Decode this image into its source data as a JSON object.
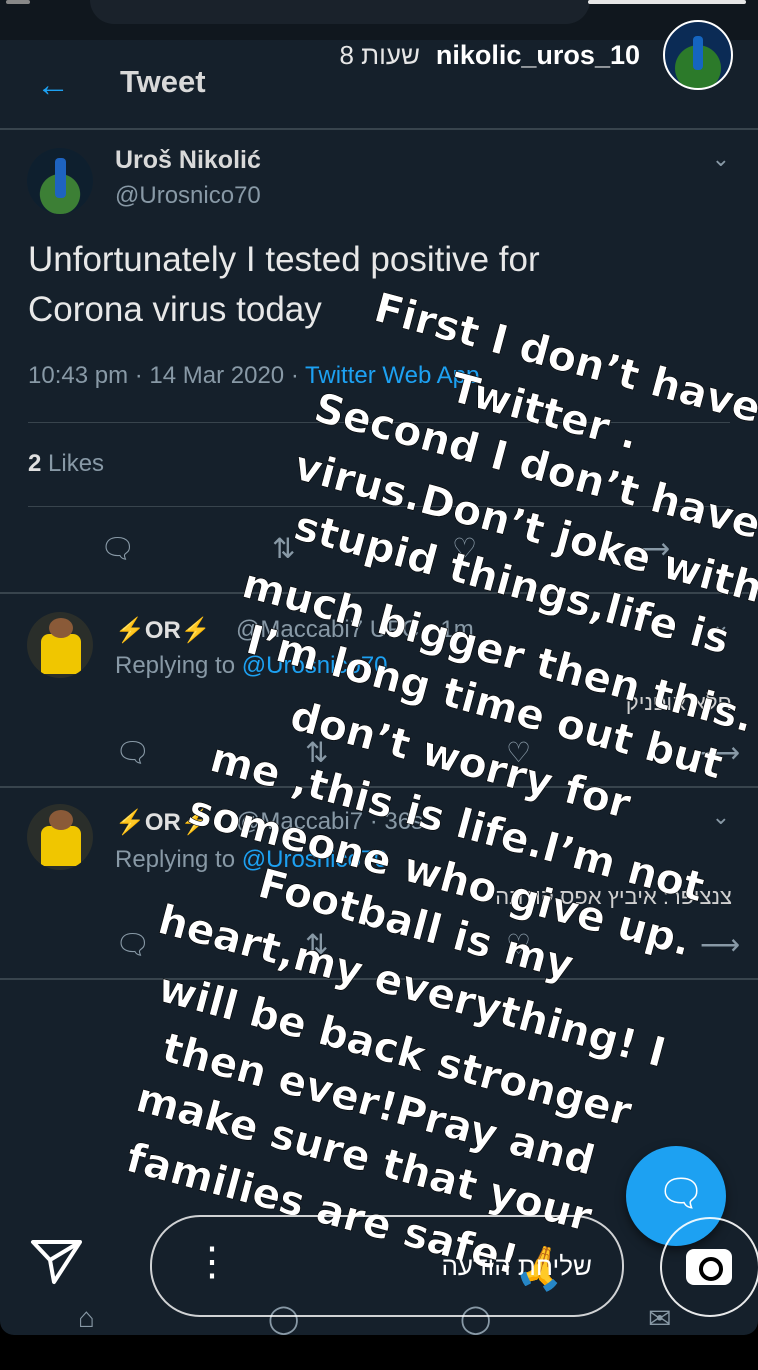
{
  "story": {
    "username": "nikolic_uros_10",
    "time": "8 שעות"
  },
  "header": {
    "back_icon": "←",
    "title": "Tweet"
  },
  "tweet": {
    "name": "Uroš Nikolić",
    "handle": "@Urosnico70",
    "text": "Unfortunately I tested positive for Corona virus today",
    "time": "10:43 pm · 14 Mar 2020 · ",
    "source": "Twitter Web App",
    "likes_count": "2",
    "likes_label": " Likes"
  },
  "replies": [
    {
      "name": "⚡OR⚡",
      "handle": "@Maccabi7 UFC · 1m",
      "replying": "Replying to ",
      "replying_to": "@Urosnico70",
      "text": "חלא אופניק"
    },
    {
      "name": "⚡OR⚡",
      "handle": "@Maccabi7 · 36s",
      "replying": "Replying to ",
      "replying_to": "@Urosnico70",
      "text": "צנציפר: איביץ אפס קורונה"
    }
  ],
  "overlay_lines": [
    "First I don’t have",
    "Twitter .",
    "Second I don’t have",
    "virus.Don’t joke with",
    "stupid things,life is",
    "much bigger then this.",
    "I’m long time out but",
    "don’t worry for",
    "me ,this is life.I’m not",
    "someone who give up.",
    "Football is my",
    "heart,my everything! I",
    "will be back stronger",
    "then ever!Pray and",
    "make sure that your",
    "families are safe!🙏"
  ],
  "reply_bar": {
    "placeholder": "שליחת הודעה",
    "dots": "⋮"
  },
  "icons": {
    "send": "send-icon",
    "camera": "camera-icon",
    "compose": "compose-icon"
  },
  "colors": {
    "background": "#15202b",
    "accent": "#1da1f2"
  }
}
